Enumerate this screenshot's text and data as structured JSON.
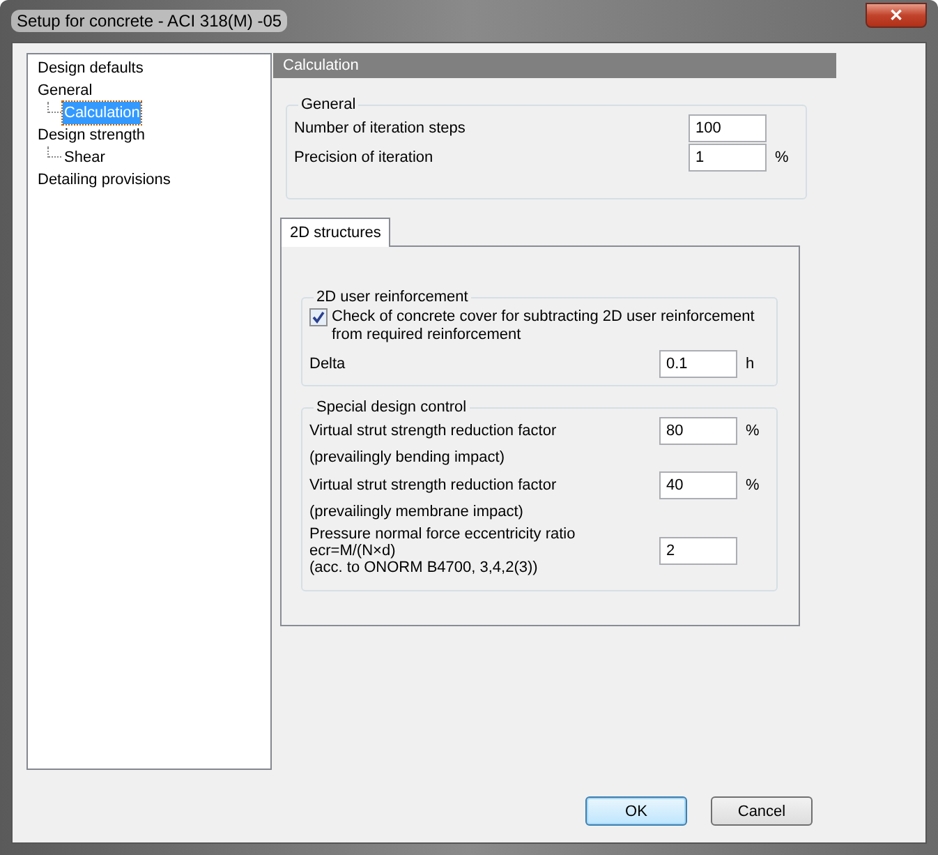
{
  "window": {
    "title": "Setup for concrete - ACI 318(M) -05",
    "close": "✕"
  },
  "tree": [
    {
      "label": "Design defaults",
      "selected": false
    },
    {
      "label": "General",
      "selected": false,
      "children": [
        {
          "label": "Calculation",
          "selected": true
        }
      ]
    },
    {
      "label": "Design strength",
      "selected": false,
      "children": [
        {
          "label": "Shear",
          "selected": false
        }
      ]
    },
    {
      "label": "Detailing provisions",
      "selected": false
    }
  ],
  "header": "Calculation",
  "general": {
    "title": "General",
    "rows": [
      {
        "label": "Number of iteration steps",
        "value": "100"
      },
      {
        "label": "Precision of iteration",
        "value": "1",
        "unit": "%"
      }
    ]
  },
  "tabs": [
    {
      "label": "2D structures",
      "selected": true
    }
  ],
  "user_reinforcement": {
    "title": "2D user reinforcement",
    "checkbox": {
      "label": "Check of concrete cover for subtracting 2D user reinforcement from required reinforcement",
      "checked": true
    },
    "delta": {
      "label": "Delta",
      "value": "0.1",
      "unit": "h"
    }
  },
  "special": {
    "title": "Special design control",
    "rows": [
      {
        "kind": "input",
        "label": "Virtual strut strength reduction factor",
        "value": "80",
        "unit": "%"
      },
      {
        "kind": "note",
        "label": "(prevailingly bending impact)"
      },
      {
        "kind": "input",
        "label": "Virtual strut strength reduction factor",
        "value": "40",
        "unit": "%"
      },
      {
        "kind": "note",
        "label": "(prevailingly membrane impact)"
      },
      {
        "kind": "multiline",
        "lines": [
          "Pressure normal force eccentricity ratio",
          "ecr=M/(N×d)",
          "(acc. to ONORM B4700, 3,4,2(3))"
        ],
        "value": "2"
      }
    ]
  },
  "buttons": [
    {
      "label": "OK",
      "default": true
    },
    {
      "label": "Cancel",
      "default": false
    }
  ]
}
